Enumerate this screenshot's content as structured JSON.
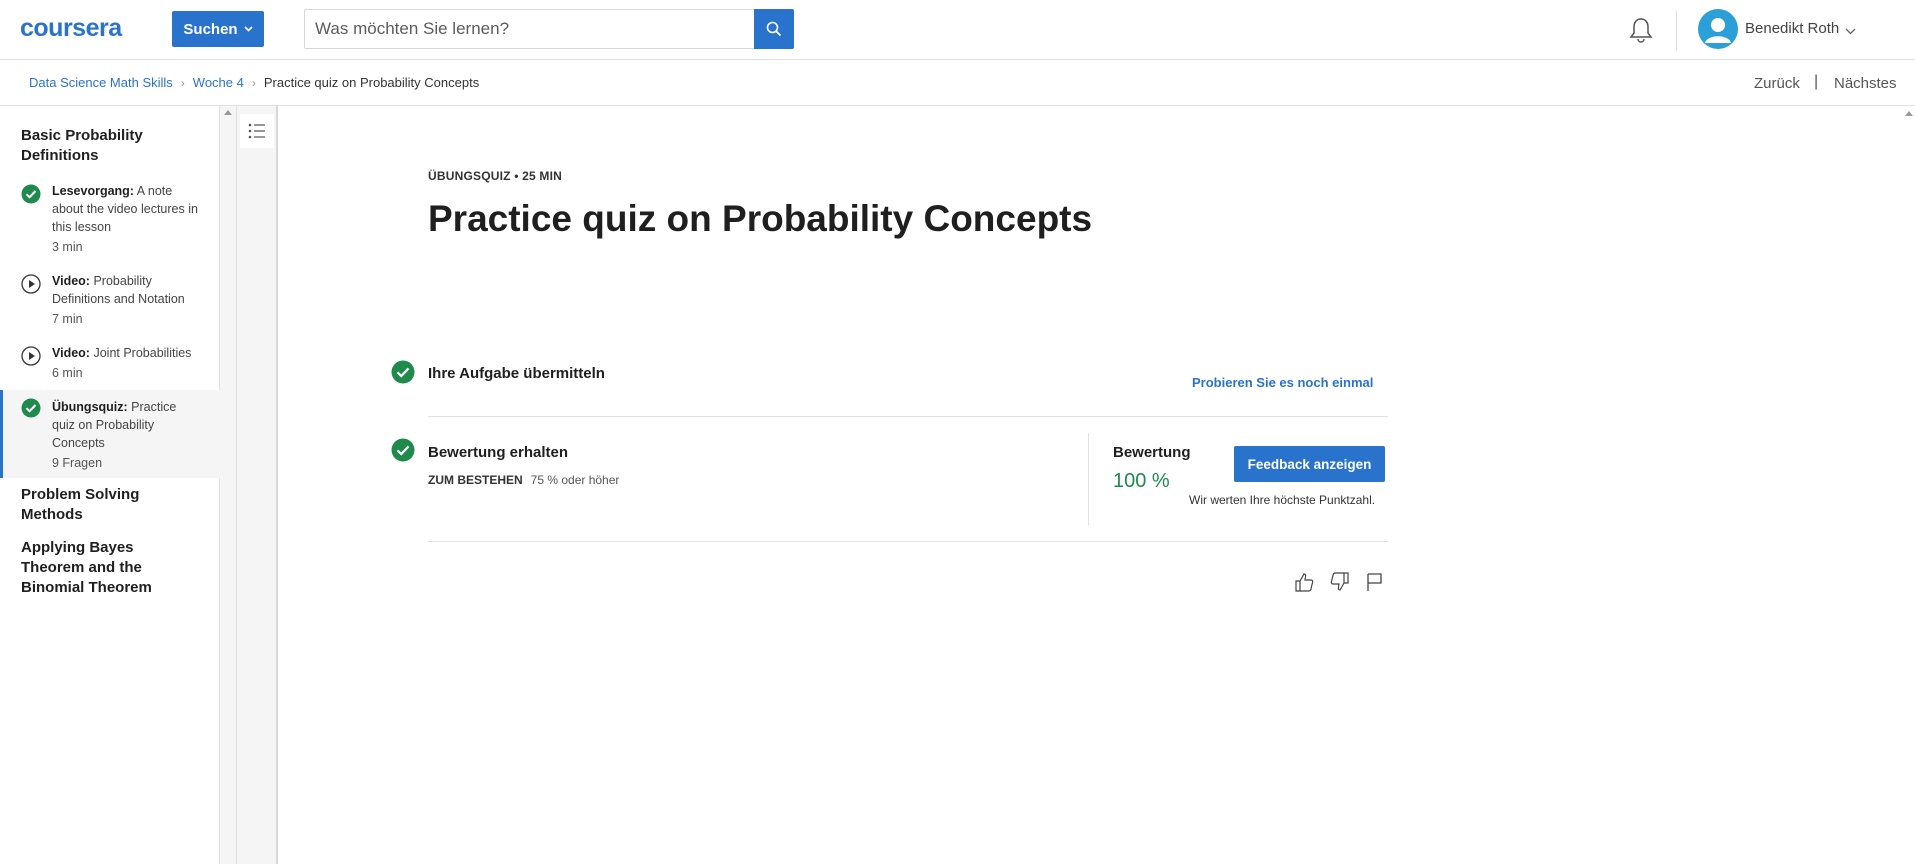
{
  "header": {
    "logo": "coursera",
    "search_button_label": "Suchen",
    "search_placeholder": "Was möchten Sie lernen?",
    "user_name": "Benedikt Roth"
  },
  "breadcrumb": {
    "items": [
      "Data Science Math Skills",
      "Woche 4"
    ],
    "current": "Practice quiz on Probability Concepts",
    "prev_label": "Zurück",
    "separator": "|",
    "next_label": "Nächstes"
  },
  "sidebar": {
    "modules": [
      {
        "title": "Basic Probability Definitions"
      },
      {
        "title": "Problem Solving Methods"
      },
      {
        "title": "Applying Bayes Theorem and the Binomial Theorem"
      }
    ],
    "items": [
      {
        "type": "Lesevorgang:",
        "title": "A note about the video lectures in this lesson",
        "duration": "3 min"
      },
      {
        "type": "Video:",
        "title": "Probability Definitions and Notation",
        "duration": "7 min"
      },
      {
        "type": "Video:",
        "title": "Joint Probabilities",
        "duration": "6 min"
      },
      {
        "type": "Übungsquiz:",
        "title": "Practice quiz on Probability Concepts",
        "duration": "9 Fragen"
      }
    ]
  },
  "main": {
    "eyebrow": "ÜBUNGSQUIZ • 25 MIN",
    "title": "Practice quiz on Probability Concepts",
    "step1": {
      "label": "Ihre Aufgabe übermitteln",
      "retry": "Probieren Sie es noch einmal"
    },
    "step2": {
      "label": "Bewertung erhalten",
      "pass_label": "ZUM BESTEHEN",
      "pass_value": "75 % oder höher"
    },
    "grade": {
      "label": "Bewertung",
      "value": "100 %",
      "note": "Wir werten Ihre höchste Punktzahl.",
      "feedback_button": "Feedback anzeigen"
    }
  },
  "colors": {
    "accent": "#2a73cc",
    "success": "#1e8a4c"
  }
}
